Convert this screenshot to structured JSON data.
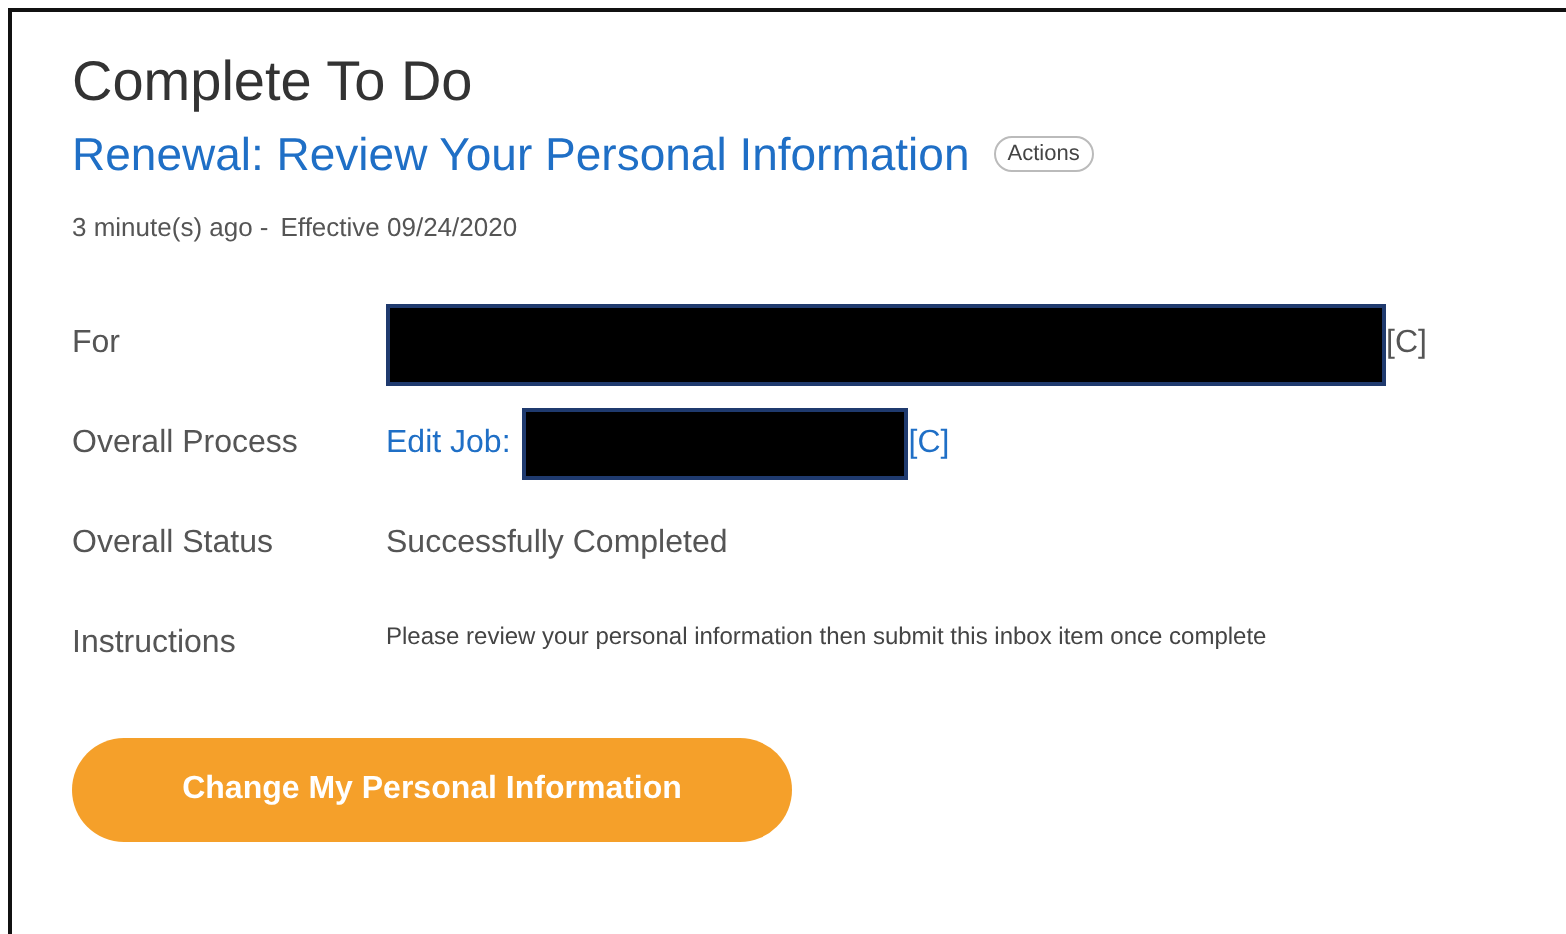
{
  "title": "Complete To Do",
  "task": {
    "title": "Renewal: Review Your Personal Information",
    "actions": "Actions"
  },
  "meta": {
    "age": "3 minute(s) ago -",
    "effective": "Effective 09/24/2020"
  },
  "fields": [
    {
      "label": "For",
      "kind": "redacted",
      "suffix": "[C]"
    },
    {
      "label": "Overall Process",
      "kind": "link",
      "link": "Edit Job:",
      "suffix": "[C]"
    },
    {
      "label": "Overall Status",
      "kind": "text",
      "value": "Successfully Completed"
    },
    {
      "label": "Instructions",
      "kind": "note",
      "value": "Please review your personal information then submit this inbox item once complete"
    }
  ],
  "button": "Change My Personal Information"
}
